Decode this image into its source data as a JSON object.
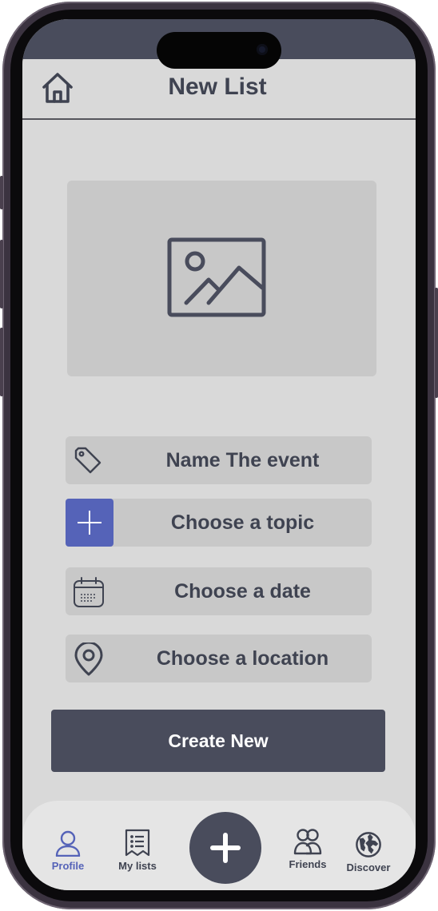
{
  "header": {
    "title": "New List",
    "home_icon": "home-icon"
  },
  "image_placeholder": {
    "icon": "image-icon"
  },
  "form": {
    "fields": [
      {
        "label": "Name The event",
        "icon": "tag-icon"
      },
      {
        "label": "Choose a topic",
        "icon": "plus-icon"
      },
      {
        "label": "Choose a date",
        "icon": "calendar-icon"
      },
      {
        "label": "Choose a location",
        "icon": "location-pin-icon"
      }
    ],
    "create_label": "Create New"
  },
  "tabbar": {
    "tabs": [
      {
        "label": "Profile",
        "icon": "user-icon",
        "active": true
      },
      {
        "label": "My lists",
        "icon": "list-icon",
        "active": false
      },
      {
        "label": "",
        "icon": "plus-icon",
        "active": false
      },
      {
        "label": "Friends",
        "icon": "friends-icon",
        "active": false
      },
      {
        "label": "Discover",
        "icon": "globe-icon",
        "active": false
      }
    ]
  },
  "colors": {
    "background": "#d9d9d9",
    "field": "#c8c8c8",
    "dark": "#494c5c",
    "text": "#3f4351",
    "accent": "#5563b8",
    "tabbar": "#e5e5e5"
  }
}
